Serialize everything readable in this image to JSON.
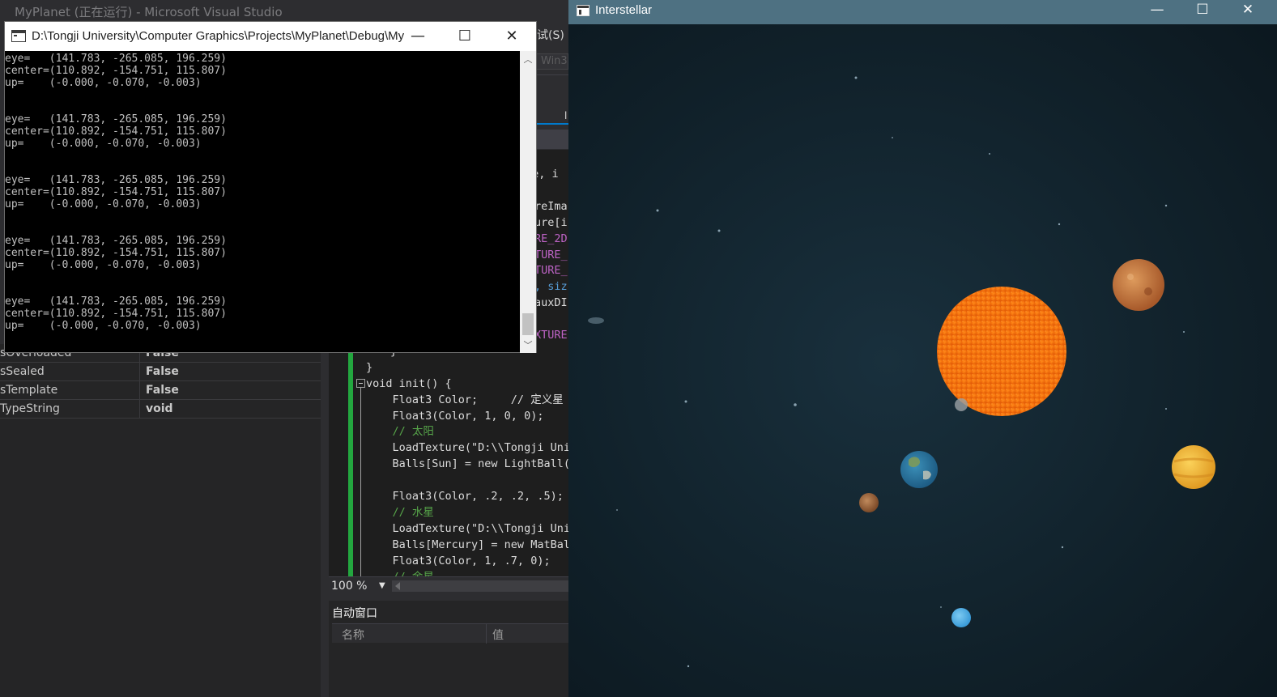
{
  "vs": {
    "title": "MyPlanet (正在运行) - Microsoft Visual Studio",
    "menu_fragment": "试(S)",
    "combo_fragment": "Win3",
    "tab_fragment": "l",
    "properties": [
      {
        "key": "sOverloaded",
        "value": "False"
      },
      {
        "key": "sSealed",
        "value": "False"
      },
      {
        "key": "sTemplate",
        "value": "False"
      },
      {
        "key": "TypeString",
        "value": "void"
      }
    ],
    "code_lines": [
      "me, i",
      "",
      "reIma",
      "ure[i",
      "RE_2D",
      "TURE_",
      "TURE_",
      ", siz",
      "auxDI",
      "",
      "XTURE",
      "}",
      "}",
      "void init() {",
      "    Float3 Color;     // 定义星",
      "    Float3(Color, 1, 0, 0);",
      "    // 太阳",
      "    LoadTexture(\"D:\\\\Tongji Uni",
      "    Balls[Sun] = new LightBall(",
      "",
      "    Float3(Color, .2, .2, .5);",
      "    // 水星",
      "    LoadTexture(\"D:\\\\Tongji Uni",
      "    Balls[Mercury] = new MatBal",
      "    Float3(Color, 1, .7, 0);",
      "    // 金星"
    ],
    "zoom": "100 %",
    "autos_title": "自动窗口",
    "autos_col_name": "名称",
    "autos_col_value": "值"
  },
  "console": {
    "title": "D:\\Tongji University\\Computer Graphics\\Projects\\MyPlanet\\Debug\\MyPlanet.exe",
    "minimize": "—",
    "maximize": "☐",
    "close": "✕",
    "lines": [
      "eye=   (141.783, -265.085, 196.259)",
      "center=(110.892, -154.751, 115.807)",
      "up=    (-0.000, -0.070, -0.003)",
      "",
      "",
      "eye=   (141.783, -265.085, 196.259)",
      "center=(110.892, -154.751, 115.807)",
      "up=    (-0.000, -0.070, -0.003)",
      "",
      "",
      "eye=   (141.783, -265.085, 196.259)",
      "center=(110.892, -154.751, 115.807)",
      "up=    (-0.000, -0.070, -0.003)",
      "",
      "",
      "eye=   (141.783, -265.085, 196.259)",
      "center=(110.892, -154.751, 115.807)",
      "up=    (-0.000, -0.070, -0.003)",
      "",
      "",
      "eye=   (141.783, -265.085, 196.259)",
      "center=(110.892, -154.751, 115.807)",
      "up=    (-0.000, -0.070, -0.003)"
    ]
  },
  "interstellar": {
    "title": "Interstellar",
    "minimize": "—",
    "maximize": "☐",
    "close": "✕",
    "colors": {
      "titlebar": "#4e7182",
      "space": "#0f1e28",
      "sun": "#f57a12",
      "earth": "#2f7fa8",
      "mercury": "#a5683e",
      "venus": "#f2b436",
      "mars": "#c77b3d",
      "neptune": "#56b6ea"
    }
  }
}
